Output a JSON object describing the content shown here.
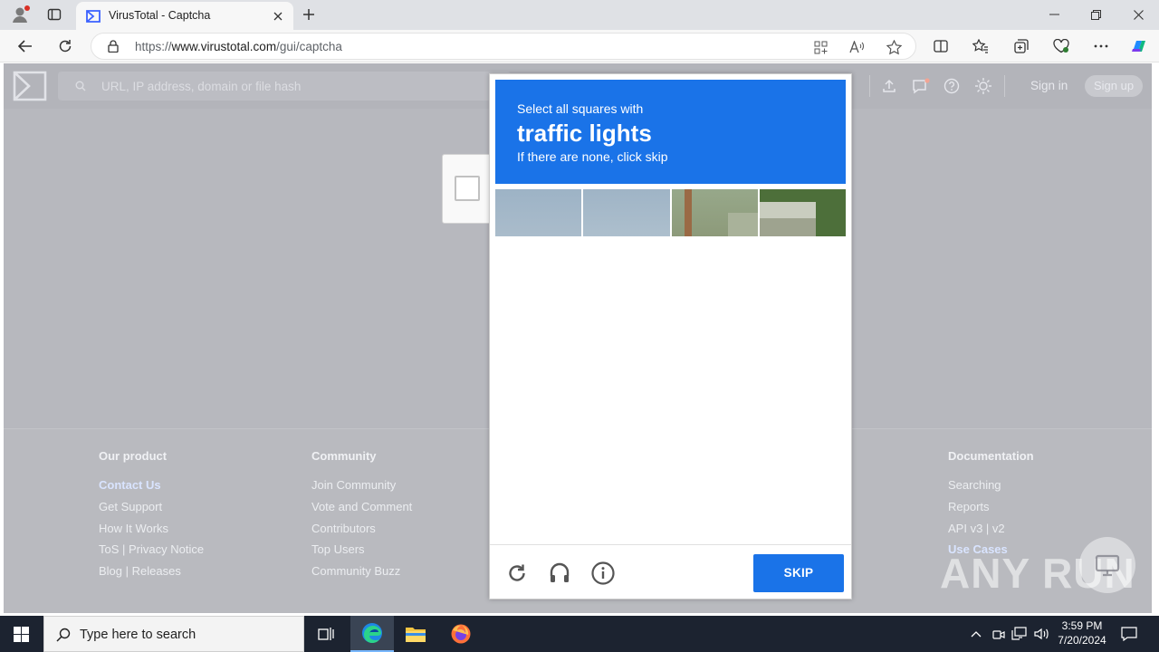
{
  "browser": {
    "tab_title": "VirusTotal - Captcha",
    "url_prefix": "https://",
    "url_domain": "www.virustotal.com",
    "url_path": "/gui/captcha"
  },
  "vt_header": {
    "search_placeholder": "URL, IP address, domain or file hash",
    "signin": "Sign in",
    "signup": "Sign up"
  },
  "footer": {
    "columns": [
      {
        "heading": "Our product",
        "links": [
          "Contact Us",
          "Get Support",
          "How It Works",
          "ToS | Privacy Notice",
          "Blog | Releases"
        ]
      },
      {
        "heading": "Community",
        "links": [
          "Join Community",
          "Vote and Comment",
          "Contributors",
          "Top Users",
          "Community Buzz"
        ]
      },
      {
        "heading": "Documentation",
        "links": [
          "Searching",
          "Reports",
          "API v3 | v2",
          "Use Cases"
        ]
      }
    ]
  },
  "captcha": {
    "line1": "Select all squares with",
    "target": "traffic lights",
    "line3": "If there are none, click skip",
    "skip_label": "SKIP",
    "accent": "#1a73e8"
  },
  "taskbar": {
    "search_placeholder": "Type here to search",
    "time": "3:59 PM",
    "date": "7/20/2024"
  },
  "watermark": "ANY RUN"
}
